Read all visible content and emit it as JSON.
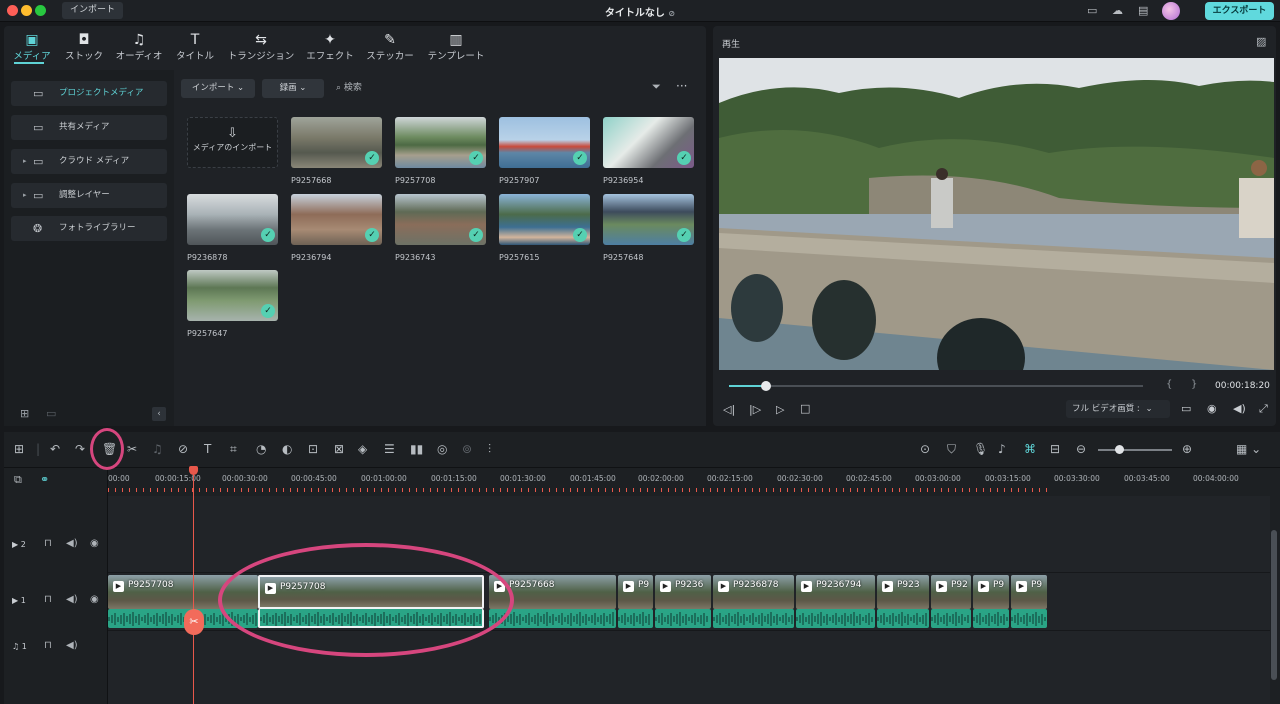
{
  "window": {
    "import_label": "インポート",
    "title": "タイトルなし",
    "export_label": "エクスポート"
  },
  "lib_tabs": [
    {
      "label": "メディア",
      "icon": "media-icon"
    },
    {
      "label": "ストック",
      "icon": "stock-icon"
    },
    {
      "label": "オーディオ",
      "icon": "audio-icon"
    },
    {
      "label": "タイトル",
      "icon": "title-icon"
    },
    {
      "label": "トランジション",
      "icon": "transition-icon"
    },
    {
      "label": "エフェクト",
      "icon": "effect-icon"
    },
    {
      "label": "ステッカー",
      "icon": "sticker-icon"
    },
    {
      "label": "テンプレート",
      "icon": "template-icon"
    }
  ],
  "sidebar": {
    "items": [
      {
        "label": "プロジェクトメディア"
      },
      {
        "label": "共有メディア"
      },
      {
        "label": "クラウド メディア"
      },
      {
        "label": "調整レイヤー"
      },
      {
        "label": "フォトライブラリー"
      }
    ]
  },
  "browser": {
    "import_dropdown": "インポート",
    "record_dropdown": "録画",
    "search_placeholder": "検索",
    "import_tile": "メディアのインポート",
    "items": [
      {
        "name": "P9257668"
      },
      {
        "name": "P9257708"
      },
      {
        "name": "P9257907"
      },
      {
        "name": "P9236954"
      },
      {
        "name": "P9236878"
      },
      {
        "name": "P9236794"
      },
      {
        "name": "P9236743"
      },
      {
        "name": "P9257615"
      },
      {
        "name": "P9257648"
      },
      {
        "name": "P9257647"
      }
    ]
  },
  "preview": {
    "title": "再生",
    "timecode": "00:00:18:20",
    "quality": "フル ビデオ画質 :",
    "progress": 0.09
  },
  "timeline": {
    "ruler": [
      "00:00",
      "00:00:15:00",
      "00:00:30:00",
      "00:00:45:00",
      "00:01:00:00",
      "00:01:15:00",
      "00:01:30:00",
      "00:01:45:00",
      "00:02:00:00",
      "00:02:15:00",
      "00:02:30:00",
      "00:02:45:00",
      "00:03:00:00",
      "00:03:15:00",
      "00:03:30:00",
      "00:03:45:00",
      "00:04:00:00"
    ],
    "tracks": [
      {
        "label": "2"
      },
      {
        "label": "1"
      },
      {
        "label": "1"
      }
    ],
    "clips": [
      {
        "name": "P9257708"
      },
      {
        "name": "P9257708"
      },
      {
        "name": "P9257668"
      },
      {
        "name": "P9"
      },
      {
        "name": "P9236"
      },
      {
        "name": "P9236878"
      },
      {
        "name": "P9236794"
      },
      {
        "name": "P923"
      },
      {
        "name": "P92"
      },
      {
        "name": "P9"
      },
      {
        "name": "P9"
      }
    ]
  },
  "colors": {
    "accent": "#5fd3d6",
    "playhead": "#e8584b",
    "annotation": "#d6467e",
    "audio": "#2aa486"
  }
}
